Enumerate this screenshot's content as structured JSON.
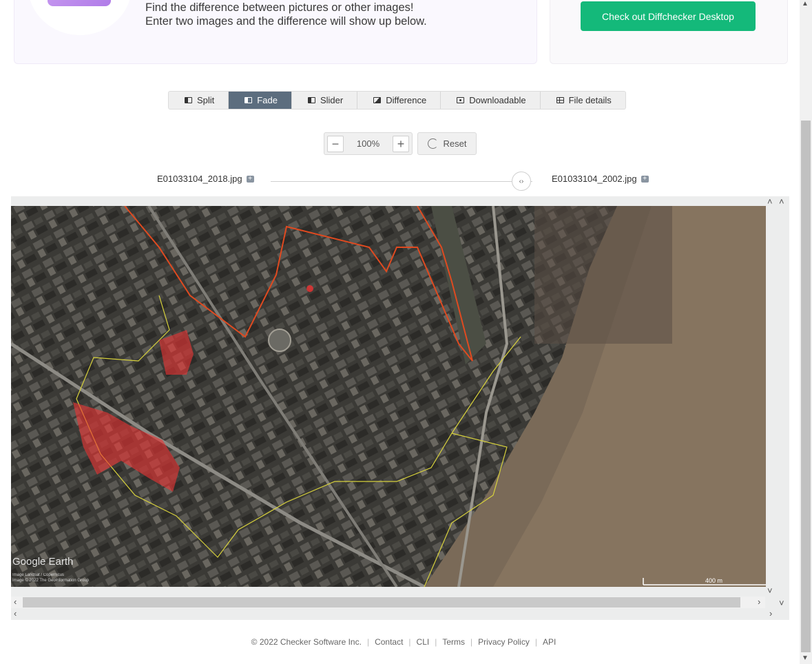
{
  "hero": {
    "line1": "Find the difference between pictures or other images!",
    "line2": "Enter two images and the difference will show up below."
  },
  "desktop_cta": "Check out Diffchecker Desktop",
  "tabs": [
    {
      "label": "Split",
      "icon": "split-view-icon"
    },
    {
      "label": "Fade",
      "icon": "fade-view-icon",
      "active": true
    },
    {
      "label": "Slider",
      "icon": "slider-view-icon"
    },
    {
      "label": "Difference",
      "icon": "difference-view-icon"
    },
    {
      "label": "Downloadable",
      "icon": "download-view-icon"
    },
    {
      "label": "File details",
      "icon": "file-details-icon"
    }
  ],
  "zoom": {
    "value": "100%",
    "minus": "−",
    "plus": "+",
    "reset": "Reset"
  },
  "files": {
    "left": "E01033104_2018.jpg",
    "right": "E01033104_2002.jpg",
    "handle": "‹›"
  },
  "map": {
    "watermark": "Google Earth",
    "credit1": "Image Landsat / Copernicus",
    "credit2": "Image © 2022 The GeoInformation Group",
    "scale": "400 m"
  },
  "footer": {
    "copyright": "© 2022 Checker Software Inc.",
    "links": [
      "Contact",
      "CLI",
      "Terms",
      "Privacy Policy",
      "API"
    ]
  },
  "colors": {
    "accent": "#14b97a",
    "tab_active": "#5c6d7e"
  }
}
